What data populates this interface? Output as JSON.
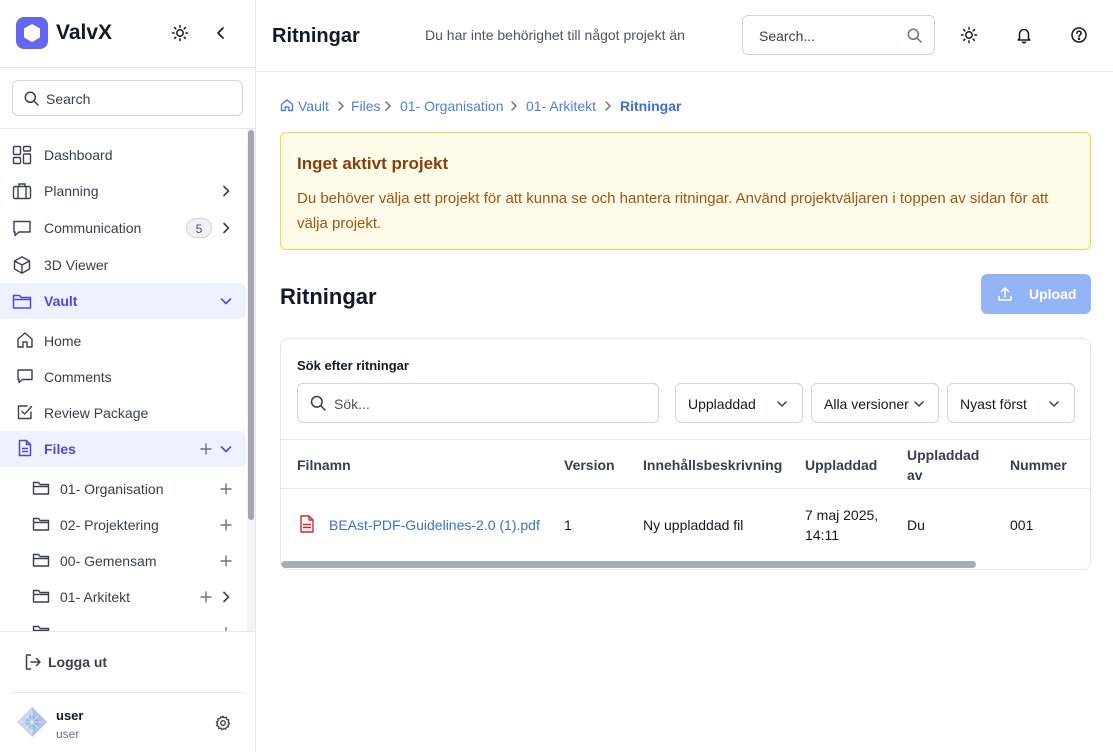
{
  "app": {
    "name": "ValvX"
  },
  "sidebar": {
    "search_placeholder": "Search",
    "items": [
      {
        "label": "Dashboard"
      },
      {
        "label": "Planning"
      },
      {
        "label": "Communication",
        "badge": "5"
      },
      {
        "label": "3D Viewer"
      },
      {
        "label": "Vault"
      }
    ],
    "vault_items": [
      {
        "label": "Home"
      },
      {
        "label": "Comments"
      },
      {
        "label": "Review Package"
      },
      {
        "label": "Files"
      }
    ],
    "folders": [
      {
        "label": "01- Organisation"
      },
      {
        "label": "02- Projektering"
      },
      {
        "label": "00- Gemensam"
      },
      {
        "label": "01- Arkitekt"
      }
    ],
    "logout_label": "Logga ut",
    "user": {
      "name": "user",
      "role": "user"
    }
  },
  "topbar": {
    "title": "Ritningar",
    "notice": "Du har inte behörighet till något projekt än",
    "search_placeholder": "Search..."
  },
  "breadcrumb": [
    "Vault",
    "Files",
    "01- Organisation",
    "01- Arkitekt",
    "Ritningar"
  ],
  "alert": {
    "title": "Inget aktivt projekt",
    "body": "Du behöver välja ett projekt för att kunna se och hantera ritningar. Använd projektväljaren i toppen av sidan för att välja projekt."
  },
  "main": {
    "title": "Ritningar",
    "upload_label": "Upload",
    "search_label": "Sök efter ritningar",
    "search_placeholder": "Sök...",
    "filters": [
      "Uppladdad",
      "Alla versioner",
      "Nyast först"
    ]
  },
  "table": {
    "headers": [
      "Filnamn",
      "Version",
      "Innehållsbeskrivning",
      "Uppladdad",
      "Uppladdad av",
      "Nummer"
    ],
    "rows": [
      {
        "filename": "BEAst-PDF-Guidelines-2.0 (1).pdf",
        "version": "1",
        "description": "Ny uppladdad fil",
        "uploaded": "7 maj 2025, 14:11",
        "uploaded_by": "Du",
        "number": "001"
      }
    ]
  },
  "colors": {
    "accent": "#6366f1",
    "link": "#3b6fd4",
    "alert_bg": "#fefce8",
    "alert_border": "#fcd34d",
    "upload_btn": "#93b4f5"
  }
}
